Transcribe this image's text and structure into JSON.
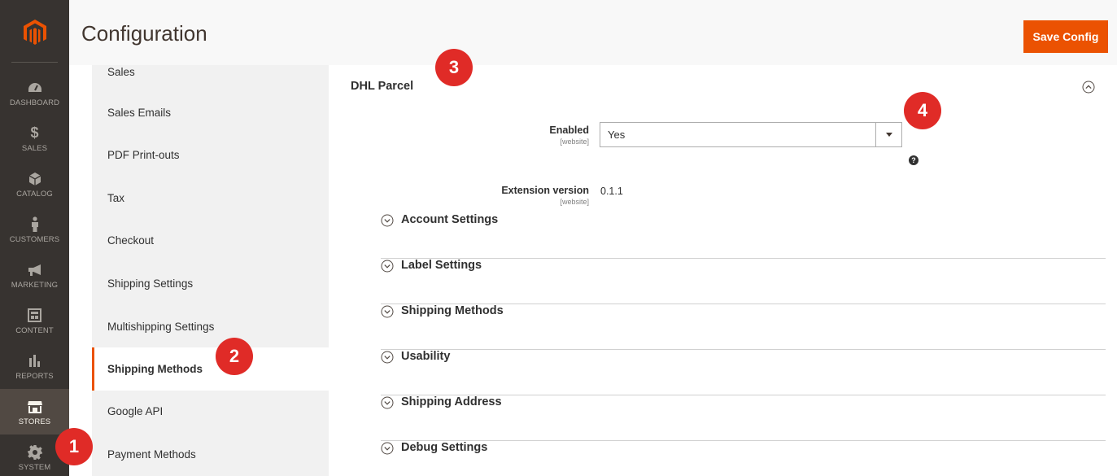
{
  "nav": {
    "items": [
      {
        "label": "DASHBOARD",
        "icon": "dashboard-icon"
      },
      {
        "label": "SALES",
        "icon": "dollar-icon"
      },
      {
        "label": "CATALOG",
        "icon": "box-icon"
      },
      {
        "label": "CUSTOMERS",
        "icon": "person-icon"
      },
      {
        "label": "MARKETING",
        "icon": "megaphone-icon"
      },
      {
        "label": "CONTENT",
        "icon": "layout-icon"
      },
      {
        "label": "REPORTS",
        "icon": "bar-chart-icon"
      },
      {
        "label": "STORES",
        "icon": "storefront-icon"
      },
      {
        "label": "SYSTEM",
        "icon": "gear-icon"
      }
    ],
    "active": "STORES"
  },
  "header": {
    "title": "Configuration",
    "save_label": "Save Config"
  },
  "config_sidebar": {
    "items": [
      "Sales",
      "Sales Emails",
      "PDF Print-outs",
      "Tax",
      "Checkout",
      "Shipping Settings",
      "Multishipping Settings",
      "Shipping Methods",
      "Google API",
      "Payment Methods"
    ],
    "active": "Shipping Methods"
  },
  "section": {
    "title": "DHL Parcel",
    "enabled": {
      "label": "Enabled",
      "scope": "[website]",
      "value": "Yes"
    },
    "extension_version": {
      "label": "Extension version",
      "scope": "[website]",
      "value": "0.1.1"
    },
    "groups": [
      "Account Settings",
      "Label Settings",
      "Shipping Methods",
      "Usability",
      "Shipping Address",
      "Debug Settings"
    ]
  },
  "markers": [
    "1",
    "2",
    "3",
    "4"
  ],
  "colors": {
    "accent": "#eb5202",
    "nav_bg": "#373330",
    "marker": "#e02b27"
  }
}
